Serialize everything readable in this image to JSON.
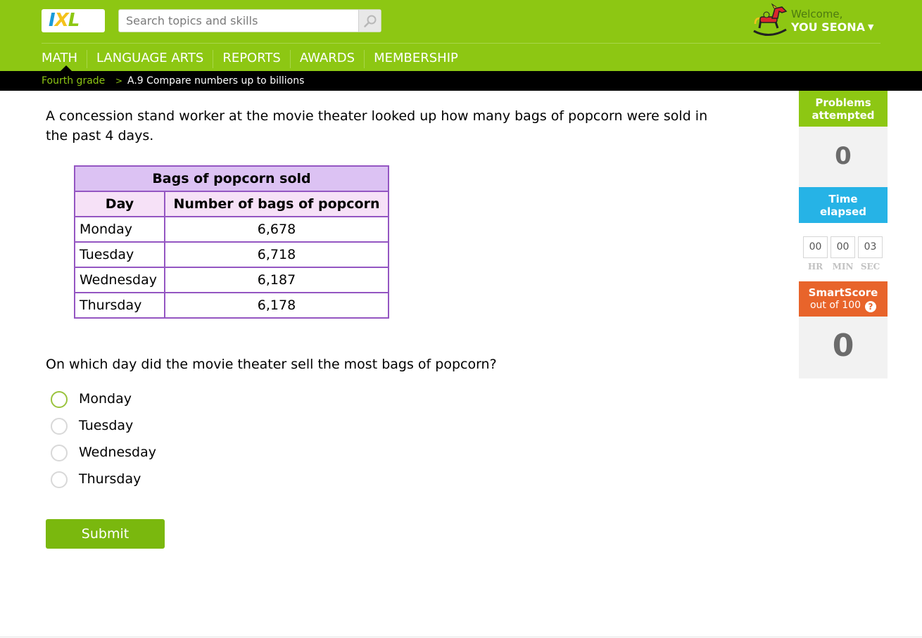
{
  "header": {
    "logo_text": "IXL",
    "search_placeholder": "Search topics and skills",
    "search_icon": "magnifier-icon",
    "welcome": "Welcome,",
    "username": "YOU SEONA",
    "avatar_icon": "rocking-horse-icon",
    "brand_color": "#8dc713"
  },
  "nav": {
    "items": [
      "MATH",
      "LANGUAGE ARTS",
      "REPORTS",
      "AWARDS",
      "MEMBERSHIP"
    ],
    "active": "MATH"
  },
  "breadcrumb": {
    "grade": "Fourth grade",
    "separator": ">",
    "skill": "A.9 Compare numbers up to billions"
  },
  "question": {
    "intro": "A concession stand worker at the movie theater looked up how many bags of popcorn were sold in the past 4 days.",
    "table": {
      "title": "Bags of popcorn sold",
      "headers": [
        "Day",
        "Number of bags of popcorn"
      ],
      "rows": [
        [
          "Monday",
          "6,678"
        ],
        [
          "Tuesday",
          "6,718"
        ],
        [
          "Wednesday",
          "6,187"
        ],
        [
          "Thursday",
          "6,178"
        ]
      ]
    },
    "prompt": "On which day did the movie theater sell the most bags of popcorn?",
    "choices": [
      "Monday",
      "Tuesday",
      "Wednesday",
      "Thursday"
    ],
    "submit_label": "Submit"
  },
  "sidebar": {
    "problems_attempted": {
      "label_line1": "Problems",
      "label_line2": "attempted",
      "value": "0"
    },
    "time_elapsed": {
      "label_line1": "Time",
      "label_line2": "elapsed",
      "hr": "00",
      "min": "00",
      "sec": "03",
      "hr_label": "HR",
      "min_label": "MIN",
      "sec_label": "SEC"
    },
    "smartscore": {
      "label": "SmartScore",
      "sub": "out of 100",
      "help": "?",
      "value": "0"
    }
  }
}
